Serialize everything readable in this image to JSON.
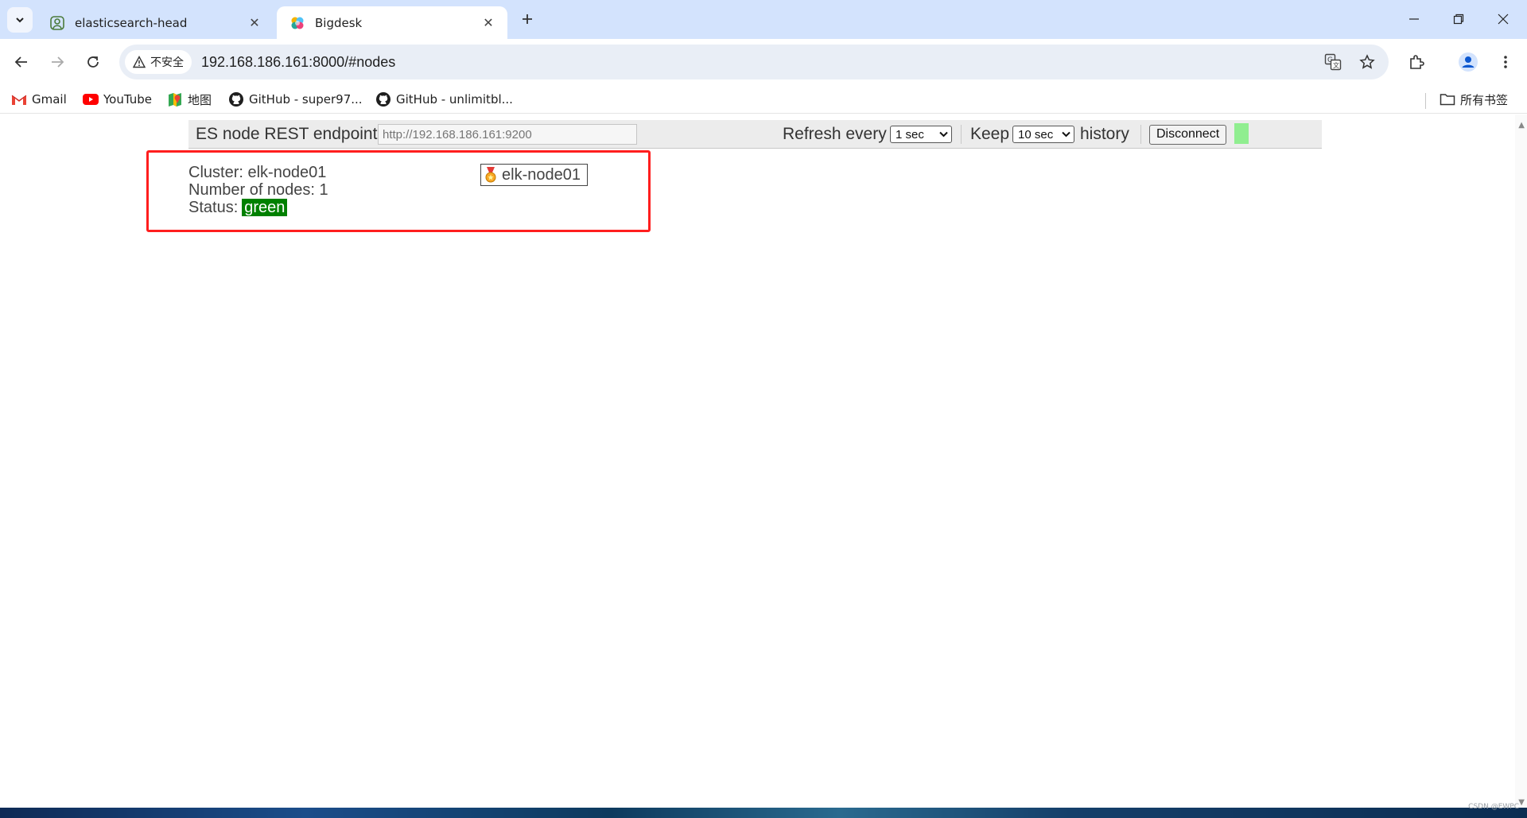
{
  "tabs": [
    {
      "title": "elasticsearch-head",
      "active": false
    },
    {
      "title": "Bigdesk",
      "active": true
    }
  ],
  "address_bar": {
    "security_label": "不安全",
    "url": "192.168.186.161:8000/#nodes"
  },
  "bookmarks": [
    {
      "label": "Gmail"
    },
    {
      "label": "YouTube"
    },
    {
      "label": "地图"
    },
    {
      "label": "GitHub - super97..."
    },
    {
      "label": "GitHub - unlimitbl..."
    }
  ],
  "all_bookmarks_label": "所有书签",
  "bigdesk": {
    "endpoint_label": "ES node REST endpoint",
    "endpoint_value": "http://192.168.186.161:9200",
    "refresh_label": "Refresh every",
    "refresh_value": "1 sec",
    "keep_label": "Keep",
    "keep_value": "10 sec",
    "history_label": "history",
    "disconnect_label": "Disconnect"
  },
  "cluster": {
    "cluster_line": "Cluster: elk-node01",
    "nodes_line": "Number of nodes: 1",
    "status_label": "Status:",
    "status_value": "green",
    "node_name": "elk-node01"
  },
  "watermark": "CSDN @EWPC",
  "colors": {
    "status_green": "#008000",
    "highlight_red": "#ff1e1e",
    "live_indicator": "#90ee90",
    "tabstrip": "#d3e3fd"
  }
}
